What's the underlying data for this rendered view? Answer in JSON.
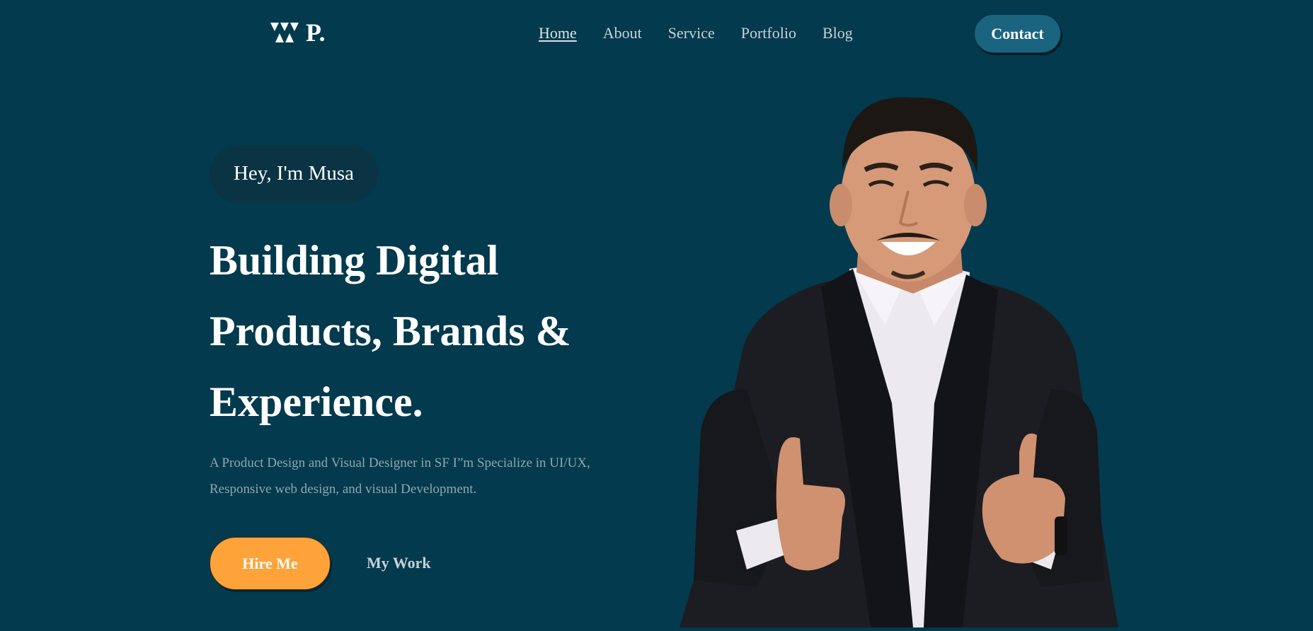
{
  "nav": {
    "logo_text": "P.",
    "links": [
      "Home",
      "About",
      "Service",
      "Portfolio",
      "Blog"
    ],
    "active": "Home",
    "contact_label": "Contact"
  },
  "hero": {
    "greeting": "Hey, I'm Musa",
    "headline": [
      "Building Digital",
      "Products, Brands &",
      "Experience."
    ],
    "description": "A Product Design and Visual Designer in SF I”m Specialize in UI/UX, Responsive web design, and visual Development.",
    "hire_label": "Hire Me",
    "work_label": "My Work"
  },
  "colors": {
    "background": "#033a4d",
    "accent": "#fda33a",
    "contact_button": "#1b6480",
    "greeting_pill": "#0a3444"
  },
  "icons": {
    "logo": "triangle-cluster-logo-icon"
  }
}
